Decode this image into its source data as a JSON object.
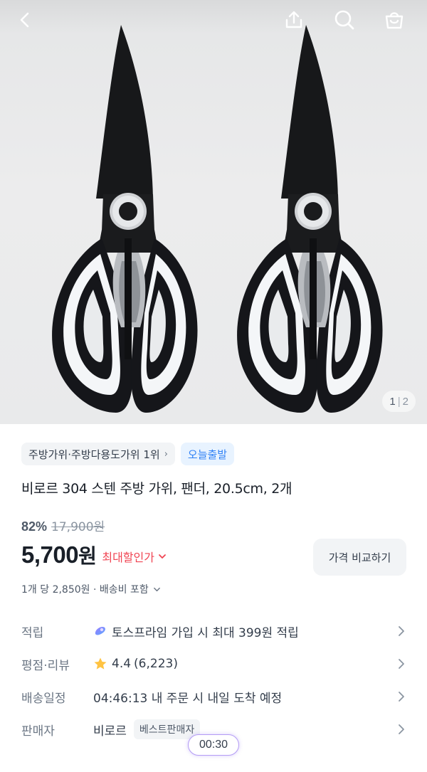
{
  "header": {
    "back_icon": "chevron-left-icon",
    "share_icon": "share-icon",
    "search_icon": "search-icon",
    "cart_icon": "shopping-bag-icon"
  },
  "gallery": {
    "current": "1",
    "separator": "|",
    "total": "2"
  },
  "product": {
    "rank_tag": "주방가위·주방다용도가위 1위",
    "delivery_tag": "오늘출발",
    "title": "비로르 304 스텐 주방 가위, 팬더, 20.5cm, 2개",
    "discount": "82%",
    "original_price": "17,900원",
    "price_number": "5,700",
    "price_unit": "원",
    "best_deal_label": "최대할인가",
    "compare_button": "가격 비교하기",
    "unit_price": "1개 당 2,850원 · 배송비 포함"
  },
  "details": {
    "points": {
      "label": "적립",
      "value": "토스프라임 가입 시 최대 399원 적립"
    },
    "rating": {
      "label": "평점·리뷰",
      "score": "4.4",
      "count": "(6,223)"
    },
    "shipping": {
      "label": "배송일정",
      "value": "04:46:13 내 주문 시 내일 도착 예정"
    },
    "seller": {
      "label": "판매자",
      "name": "비로르",
      "badge": "베스트판매자"
    }
  },
  "timer": "00:30",
  "colors": {
    "accent_blue": "#3182f6",
    "sale_red": "#f04452",
    "star": "#ffc342"
  }
}
